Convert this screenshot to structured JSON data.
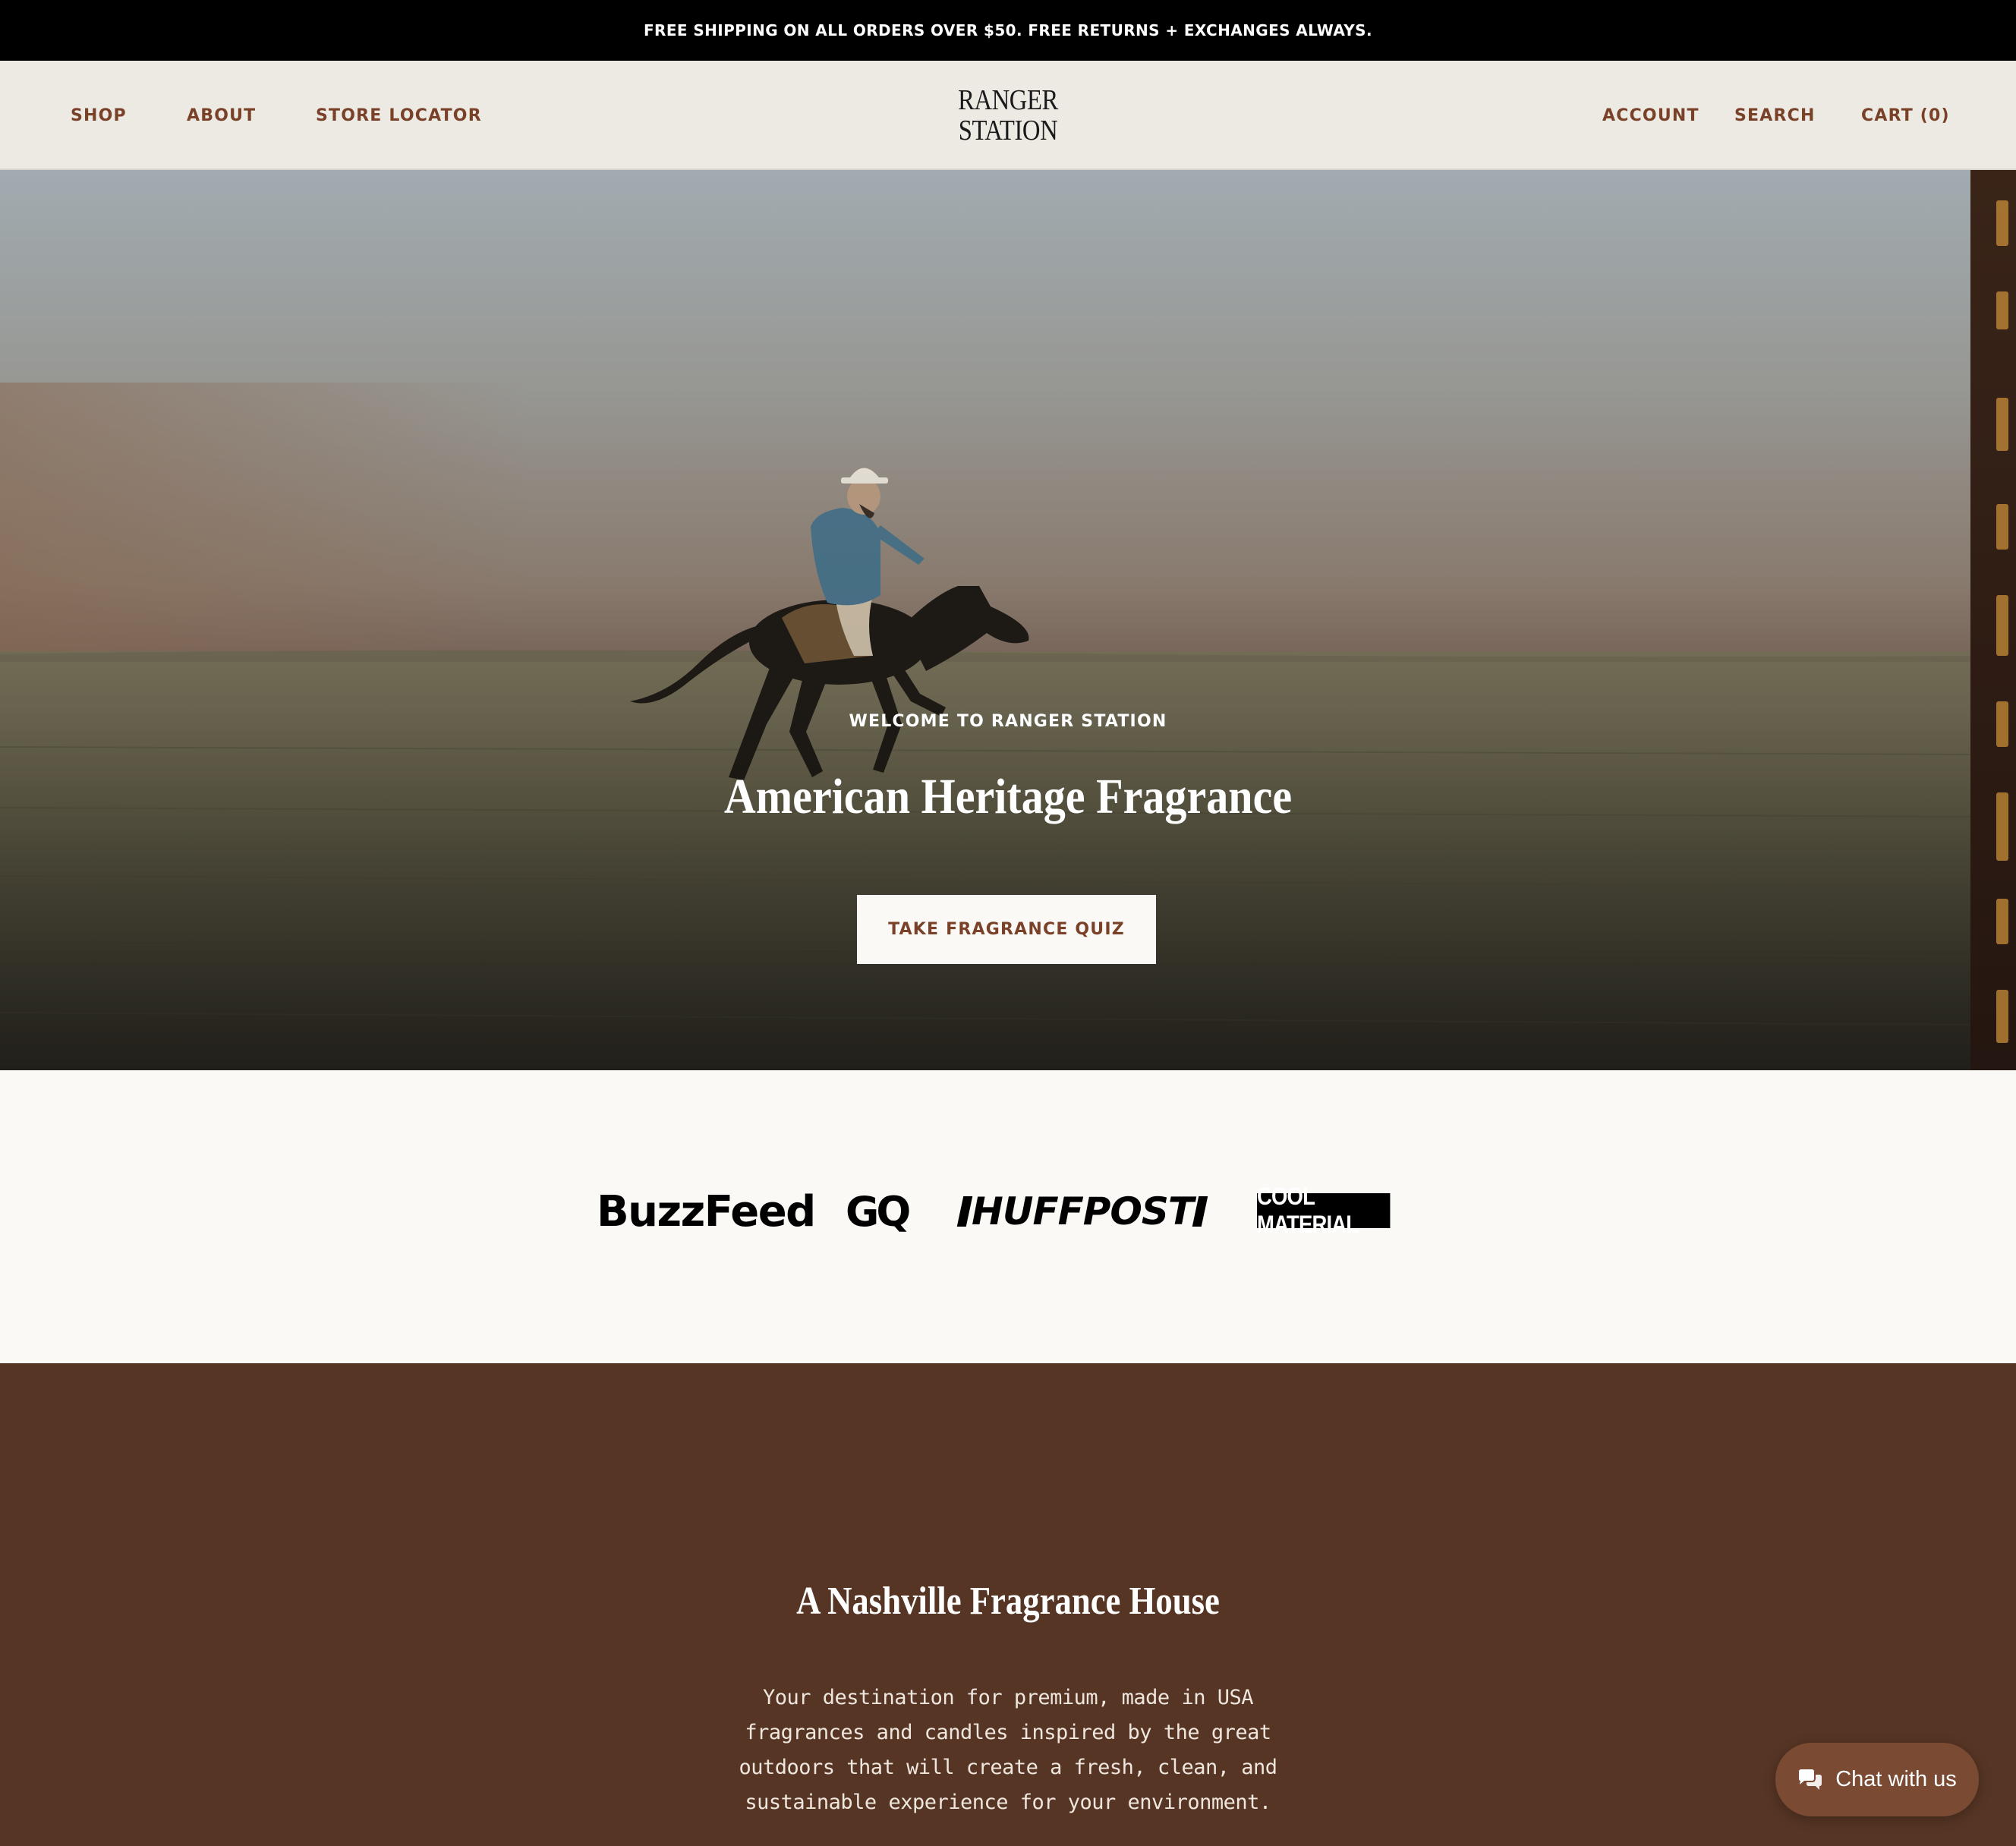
{
  "announcement": {
    "text": "FREE SHIPPING ON ALL ORDERS OVER $50. FREE RETURNS + EXCHANGES ALWAYS."
  },
  "header": {
    "nav_left": [
      "SHOP",
      "ABOUT",
      "STORE LOCATOR"
    ],
    "logo_line1": "RANGER",
    "logo_line2": "STATION",
    "nav_right": [
      "ACCOUNT",
      "SEARCH",
      "CART (0)"
    ]
  },
  "hero": {
    "eyebrow": "WELCOME TO RANGER STATION",
    "title": "American Heritage Fragrance",
    "cta_label": "TAKE FRAGRANCE QUIZ"
  },
  "press": {
    "logos": [
      "BuzzFeed",
      "GQ",
      "HUFFPOST",
      "COOL MATERIAL"
    ]
  },
  "about": {
    "title": "A Nashville Fragrance House",
    "body": "Your destination for premium, made in USA fragrances and candles inspired by the great outdoors that will create a fresh, clean, and sustainable experience for your environment."
  },
  "chat": {
    "label": "Chat with us",
    "icon": "chat-bubbles-icon"
  },
  "colors": {
    "accent_brown": "#7A4129",
    "section_brown": "#563524",
    "header_bg": "#EDEAE4",
    "page_bg": "#FAF9F5"
  }
}
